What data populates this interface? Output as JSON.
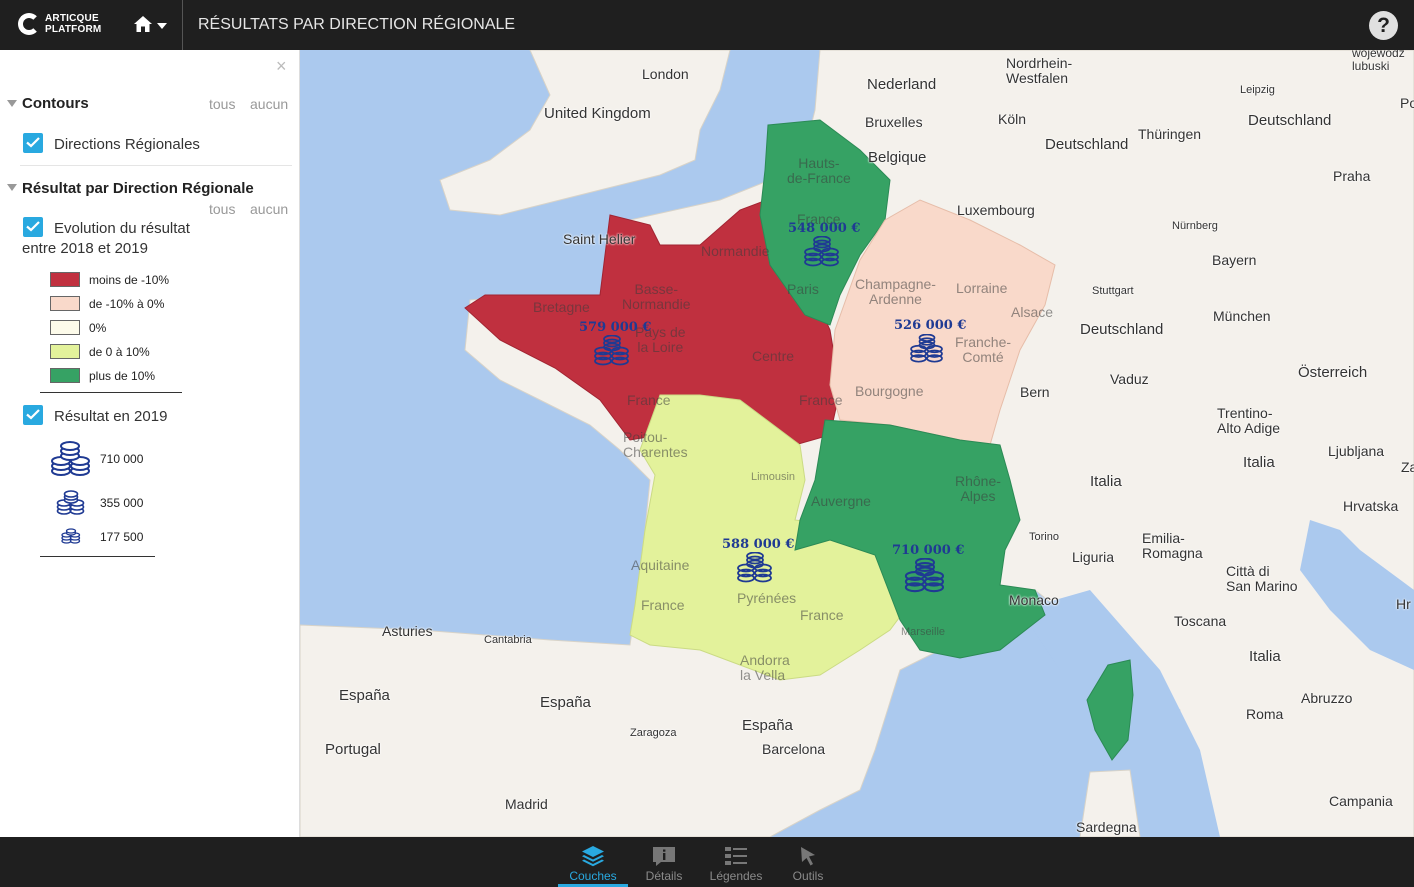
{
  "header": {
    "logo_line1": "ARTICQUE",
    "logo_line2": "PLATFORM",
    "title": "RÉSULTATS PAR DIRECTION RÉGIONALE",
    "help_label": "?"
  },
  "sidebar": {
    "close_label": "×",
    "groups": [
      {
        "title": "Contours",
        "all_label": "tous",
        "none_label": "aucun",
        "layers": [
          {
            "label": "Directions Régionales",
            "checked": true
          }
        ]
      },
      {
        "title": "Résultat par Direction Régionale",
        "all_label": "tous",
        "none_label": "aucun",
        "layers": [
          {
            "label_line1": "Evolution du résultat",
            "label_line2": "entre 2018 et 2019",
            "checked": true,
            "legend": [
              {
                "label": "moins de -10%",
                "color": "#c0303f"
              },
              {
                "label": "de -10% à 0%",
                "color": "#f9d9ca"
              },
              {
                "label": "0%",
                "color": "#fdfbea"
              },
              {
                "label": "de 0 à 10%",
                "color": "#e3f29b"
              },
              {
                "label": "plus de 10%",
                "color": "#36a264"
              }
            ]
          },
          {
            "label": "Résultat en 2019",
            "checked": true,
            "legend": [
              {
                "label": "710 000"
              },
              {
                "label": "355 000"
              },
              {
                "label": "177 500"
              }
            ]
          }
        ]
      }
    ]
  },
  "map": {
    "region_colors": {
      "less_than_minus_10": "#c0303f",
      "minus_10_to_0": "#f9d9ca",
      "zero_to_10": "#e3f29b",
      "more_than_10": "#36a264"
    },
    "values": [
      {
        "label": "548 000 €"
      },
      {
        "label": "579 000 €"
      },
      {
        "label": "526 000 €"
      },
      {
        "label": "588 000 €"
      },
      {
        "label": "710 000 €"
      }
    ],
    "place_labels": {
      "london": "London",
      "uk": "United Kingdom",
      "nederland": "Nederland",
      "nrw": "Nordrhein-\nWestfalen",
      "bruxelles": "Bruxelles",
      "belgique": "Belgique",
      "koln": "Köln",
      "leipzig": "Leipzig",
      "deutschland1": "Deutschland",
      "deutschland2": "Deutschland",
      "deutschland3": "Deutschland",
      "thuringen": "Thüringen",
      "luxembourg": "Luxembourg",
      "nurnberg": "Nürnberg",
      "praha": "Praha",
      "bayern": "Bayern",
      "stuttgart": "Stuttgart",
      "munchen": "München",
      "vaduz": "Vaduz",
      "bern": "Bern",
      "osterreich": "Österreich",
      "trentino": "Trentino-\nAlto Adige",
      "ljubljana": "Ljubljana",
      "italia1": "Italia",
      "italia2": "Italia",
      "italia3": "Italia",
      "torino": "Torino",
      "liguria": "Liguria",
      "emilia": "Emilia-\nRomagna",
      "sanmarino": "Città di\nSan Marino",
      "hrvatska": "Hrvatska",
      "toscana": "Toscana",
      "abruzzo": "Abruzzo",
      "roma": "Roma",
      "campania": "Campania",
      "sardegna": "Sardegna",
      "monaco": "Monaco",
      "saint_helier": "Saint Helier",
      "asturies": "Asturies",
      "cantabria": "Cantabria",
      "espana1": "España",
      "espana2": "España",
      "espana3": "España",
      "portugal": "Portugal",
      "zaragoza": "Zaragoza",
      "andorra": "Andorra\nla Vella",
      "barcelona": "Barcelona",
      "madrid": "Madrid",
      "wojewodz": "wojewodz\nlubuski",
      "po": "Po",
      "za": "Za",
      "hr": "Hr"
    },
    "region_names": {
      "hauts_de_france": "Hauts-\nde-France",
      "normandie": "Normandie",
      "bretagne": "Bretagne",
      "basse_normandie": "Basse-\nNormandie",
      "pays_de_la_loire": "Pays de\nla Loire",
      "centre": "Centre",
      "champagne": "Champagne-\nArdenne",
      "lorraine": "Lorraine",
      "alsace": "Alsace",
      "franche_comte": "Franche-\nComté",
      "bourgogne": "Bourgogne",
      "poitou": "Poitou-\nCharentes",
      "limousin": "Limousin",
      "auvergne": "Auvergne",
      "rhone_alpes": "Rhône-\nAlpes",
      "aquitaine": "Aquitaine",
      "pyrenees": "Pyrénées",
      "marseille": "Marseille",
      "france1": "France",
      "france2": "France",
      "france3": "France",
      "france4": "France",
      "france5": "France",
      "paris": "Paris"
    }
  },
  "bottom_tabs": [
    {
      "label": "Couches",
      "icon": "layers-icon",
      "active": true
    },
    {
      "label": "Détails",
      "icon": "details-icon",
      "active": false
    },
    {
      "label": "Légendes",
      "icon": "legend-list-icon",
      "active": false
    },
    {
      "label": "Outils",
      "icon": "pointer-icon",
      "active": false
    }
  ]
}
